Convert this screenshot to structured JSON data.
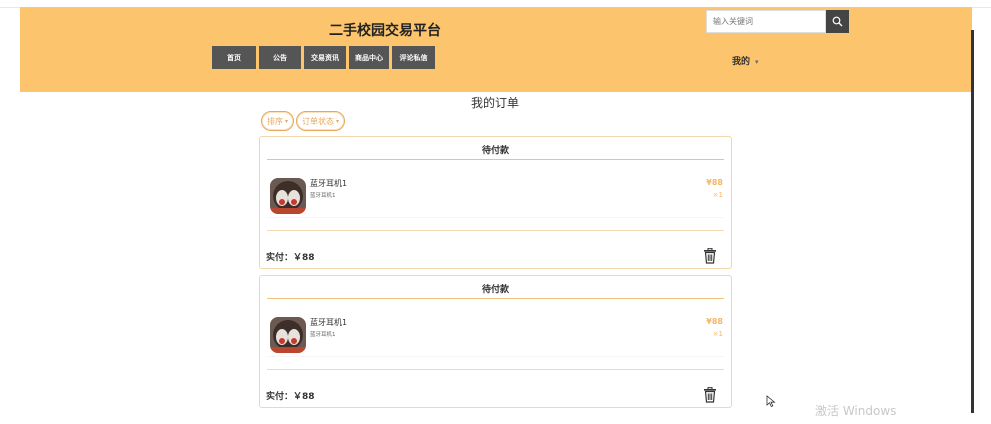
{
  "header": {
    "site_title": "二手校园交易平台",
    "search_placeholder": "输入关键词",
    "nav_items": [
      {
        "label": "首页"
      },
      {
        "label": "公告"
      },
      {
        "label": "交易资讯"
      },
      {
        "label": "商品中心"
      },
      {
        "label": "评论私信"
      }
    ],
    "user_menu": "我的",
    "background_color": "#fcc56d"
  },
  "main": {
    "page_title": "我的订单",
    "filters": [
      {
        "label": "排序"
      },
      {
        "label": "订单状态"
      }
    ],
    "orders": [
      {
        "status": "待付款",
        "item_name": "蓝牙耳机1",
        "item_desc": "蓝牙耳机1",
        "price": "¥88",
        "quantity": "×1",
        "total": "实付：￥88"
      },
      {
        "status": "待付款",
        "item_name": "蓝牙耳机1",
        "item_desc": "蓝牙耳机1",
        "price": "¥88",
        "quantity": "×1",
        "total": "实付：￥88"
      }
    ],
    "accent_color": "#f5b663"
  },
  "overlay": {
    "watermark": "激活 Windows"
  }
}
